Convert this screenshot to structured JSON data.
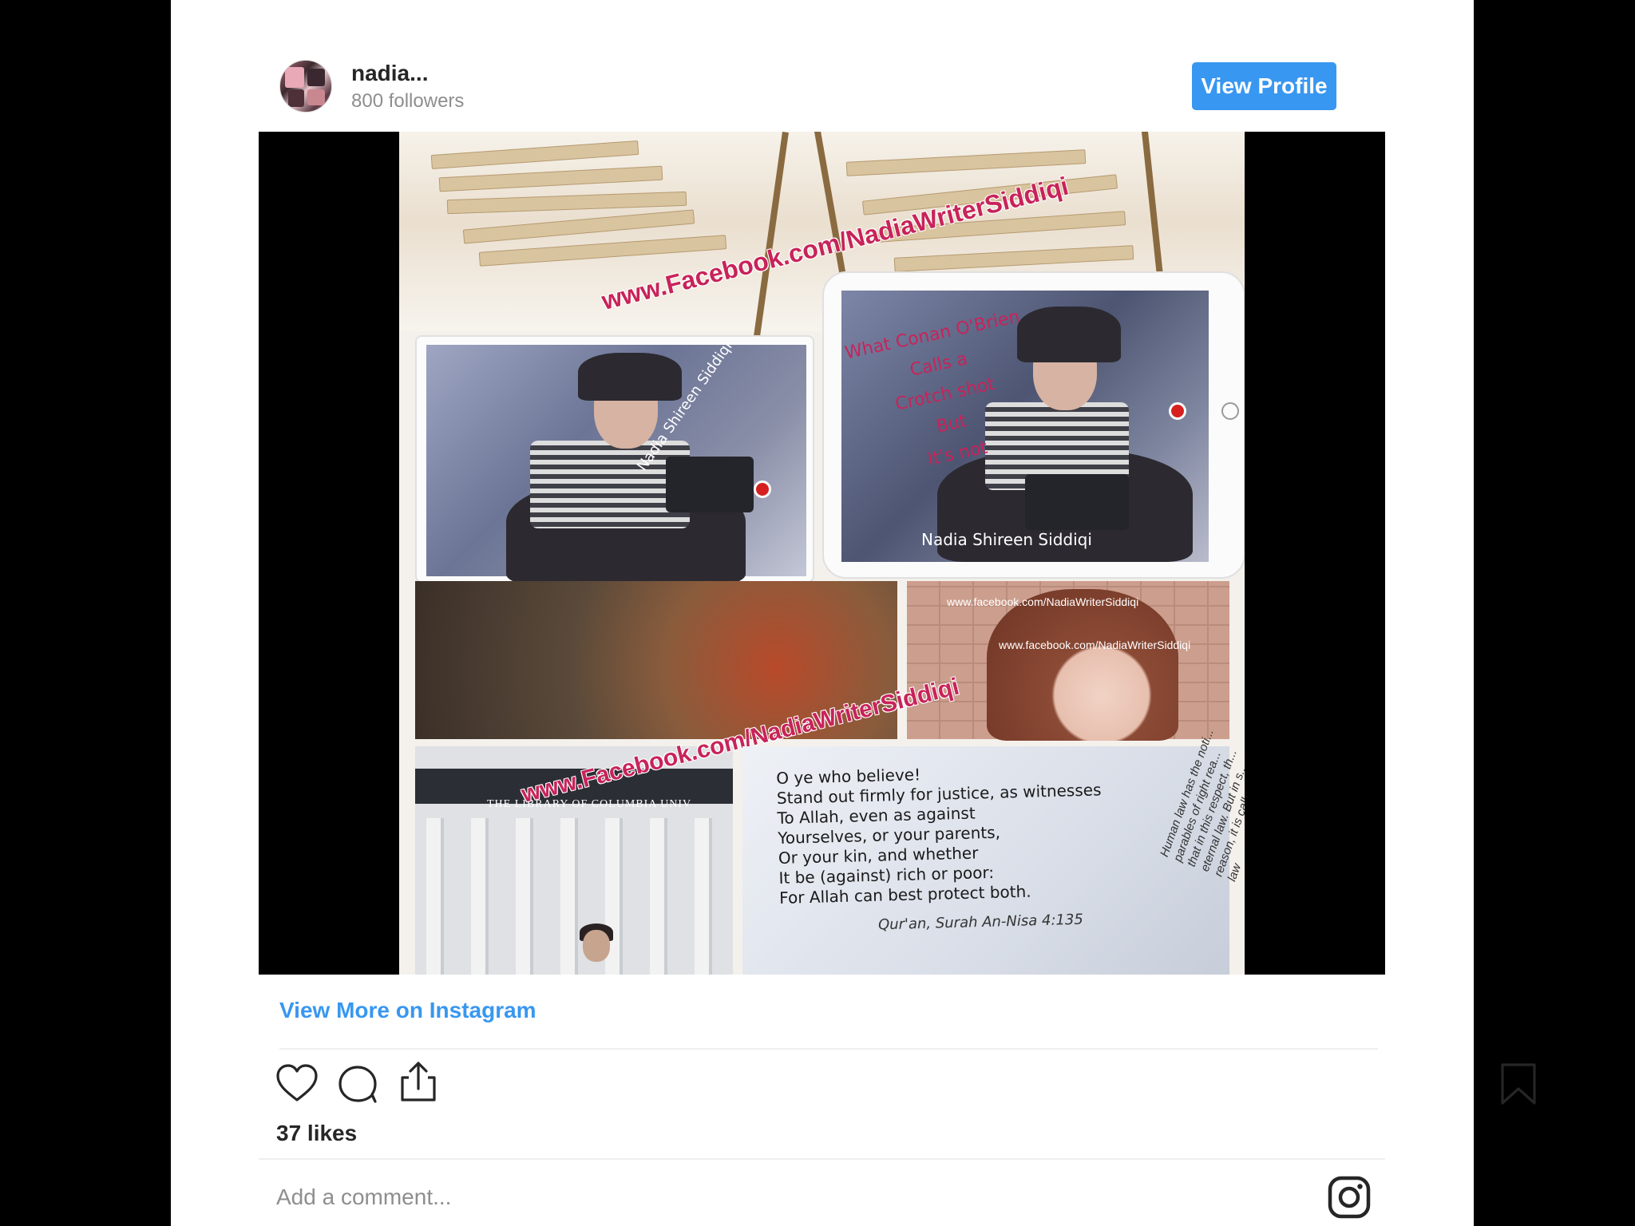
{
  "profile": {
    "username": "nadia...",
    "followers": "800 followers",
    "view_profile_label": "View Profile"
  },
  "media": {
    "watermark_top": "www.Facebook.com/NadiaWriterSiddiqi",
    "watermark_middle": "www.Facebook.com/NadiaWriterSiddiqi",
    "watermark_small_1": "www.facebook.com/NadiaWriterSiddiqi",
    "watermark_small_2": "www.facebook.com/NadiaWriterSiddiqi",
    "left_overlay_name": "Nadia Shireen Siddiqi",
    "right_overlay_name": "Nadia Shireen Siddiqi",
    "caption_lines": [
      "What Conan O'Brien",
      "Calls a",
      "Crotch shot",
      "But",
      "It's not"
    ],
    "library_inscription": "THE LIBRARY OF COLUMBIA UNIV",
    "quote_lines": [
      "O ye who believe!",
      "Stand out firmly for justice, as witnesses",
      "To Allah, even as against",
      "Yourselves, or your parents,",
      "Or your kin, and whether",
      "It be (against) rich or poor:",
      "For Allah can best protect both."
    ],
    "quote_citation": "Qur'an, Surah An-Nisa   4:135",
    "side_text": "Human law has the noti... parables of right rea... that in this respect, th... eternal law. But in s... reason, it is called ...al law",
    "next_icon": "chevron-right-icon"
  },
  "footer": {
    "view_more_label": "View More on Instagram",
    "likes": "37 likes",
    "comment_placeholder": "Add a comment...",
    "icons": [
      "heart-icon",
      "comment-icon",
      "share-icon",
      "bookmark-icon",
      "instagram-logo-icon"
    ]
  },
  "colors": {
    "accent": "#3897f0",
    "text": "#262626",
    "muted": "#8e8e8e",
    "watermark": "#c8235a"
  }
}
